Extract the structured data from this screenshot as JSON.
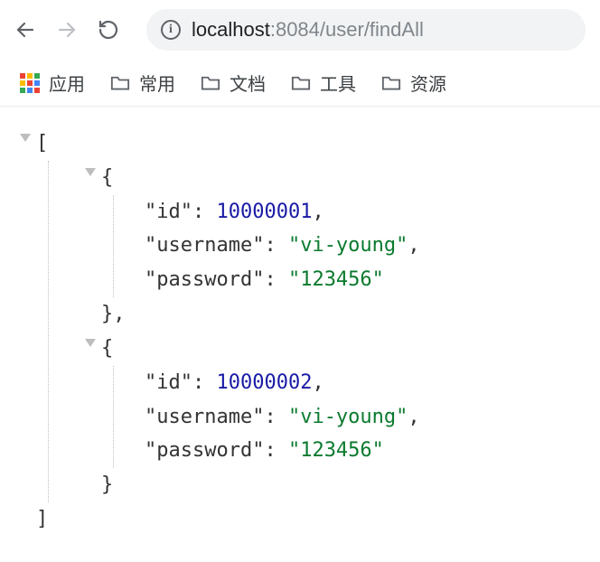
{
  "nav": {
    "url_host": "localhost",
    "url_port": ":8084",
    "url_path": "/user/findAll"
  },
  "bookmarks": {
    "apps_label": "应用",
    "folders": [
      "常用",
      "文档",
      "工具",
      "资源"
    ]
  },
  "json": {
    "open_array": "[",
    "close_array": "]",
    "open_obj": "{",
    "close_obj": "}",
    "close_obj_comma": "},",
    "comma": ",",
    "colon": ": ",
    "records": [
      {
        "id_key": "\"id\"",
        "id_val": "10000001",
        "un_key": "\"username\"",
        "un_val": "\"vi-young\"",
        "pw_key": "\"password\"",
        "pw_val": "\"123456\""
      },
      {
        "id_key": "\"id\"",
        "id_val": "10000002",
        "un_key": "\"username\"",
        "un_val": "\"vi-young\"",
        "pw_key": "\"password\"",
        "pw_val": "\"123456\""
      }
    ]
  }
}
